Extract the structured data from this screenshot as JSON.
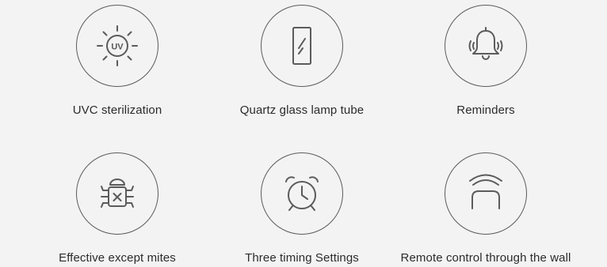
{
  "features": [
    {
      "icon": "uv-sun-icon",
      "label": "UVC sterilization",
      "icon_text": "UV"
    },
    {
      "icon": "quartz-tube-icon",
      "label": "Quartz glass lamp tube"
    },
    {
      "icon": "bell-icon",
      "label": "Reminders"
    },
    {
      "icon": "bug-x-icon",
      "label": "Effective except mites"
    },
    {
      "icon": "alarm-clock-icon",
      "label": "Three timing Settings"
    },
    {
      "icon": "wireless-arch-icon",
      "label": "Remote control through the wall"
    }
  ],
  "colors": {
    "background": "#f3f3f3",
    "stroke": "#5b5b5b",
    "text": "#2b2b2b"
  }
}
